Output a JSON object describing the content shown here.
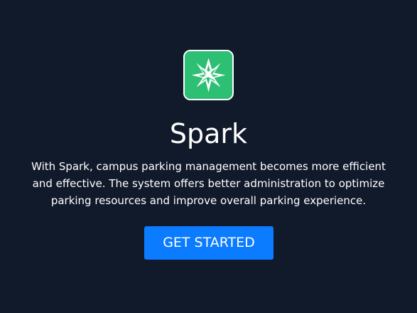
{
  "brand": {
    "logo_icon": "spark-star-icon",
    "logo_color": "#2dbf73",
    "name": "Spark"
  },
  "hero": {
    "description": "With Spark, campus parking management becomes more efficient and effective. The system offers better administration to optimize parking resources and improve overall parking experience.",
    "cta_label": "GET STARTED"
  },
  "colors": {
    "background": "#111a2b",
    "accent": "#0b7bff",
    "text": "#ffffff"
  }
}
